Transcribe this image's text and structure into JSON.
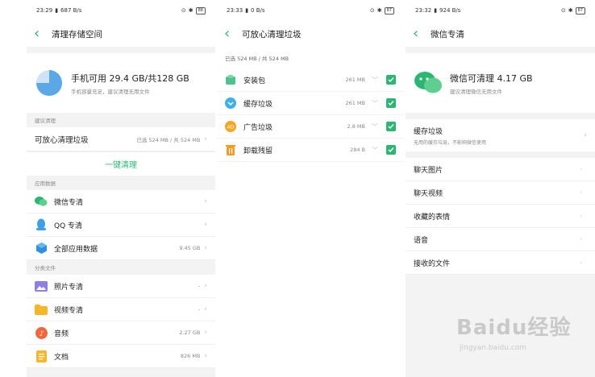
{
  "screen1": {
    "status": {
      "time": "23:29",
      "speed": "687 B/s",
      "battery": "88"
    },
    "title": "清理存储空间",
    "summary": {
      "main": "手机可用 29.4 GB/共128 GB",
      "sub": "手机容量充足，建议清理无用文件"
    },
    "section_suggest": "建议清理",
    "safe_clean": {
      "label": "可放心清理垃圾",
      "value": "已选 524 MB / 共 524 MB"
    },
    "one_key": "一键清理",
    "section_apps": "应用数据",
    "apps": [
      {
        "label": "微信专清",
        "value": ""
      },
      {
        "label": "QQ 专清",
        "value": ""
      },
      {
        "label": "全部应用数据",
        "value": "9.45 GB"
      }
    ],
    "section_files": "分类文件",
    "files": [
      {
        "label": "照片专清",
        "value": "-"
      },
      {
        "label": "视频专清",
        "value": "-"
      },
      {
        "label": "音频",
        "value": "2.27 GB"
      },
      {
        "label": "文档",
        "value": "826 MB"
      }
    ]
  },
  "screen2": {
    "status": {
      "time": "23:33",
      "speed": "0 B/s",
      "battery": "87"
    },
    "title": "可放心清理垃圾",
    "selected": "已选 524 MB / 共 524 MB",
    "items": [
      {
        "label": "安装包",
        "value": "261 MB"
      },
      {
        "label": "缓存垃圾",
        "value": "261 MB"
      },
      {
        "label": "广告垃圾",
        "value": "2.8 MB"
      },
      {
        "label": "卸载残留",
        "value": "284 B"
      }
    ]
  },
  "screen3": {
    "status": {
      "time": "23:32",
      "speed": "924 B/s",
      "battery": "87"
    },
    "title": "微信专清",
    "summary": {
      "main": "微信可清理 4.17 GB",
      "sub": "建议清理微信无用文件"
    },
    "cache": {
      "label": "缓存垃圾",
      "sub": "无用的缓存垃圾，不影响微信使用"
    },
    "items": [
      {
        "label": "聊天图片"
      },
      {
        "label": "聊天视频"
      },
      {
        "label": "收藏的表情"
      },
      {
        "label": "语音"
      },
      {
        "label": "接收的文件"
      }
    ]
  },
  "watermark": {
    "main": "Baidu经验",
    "sub": "jingyan.baidu.com"
  },
  "colors": {
    "accent": "#2bb673",
    "pie": "#5aa9e6"
  }
}
